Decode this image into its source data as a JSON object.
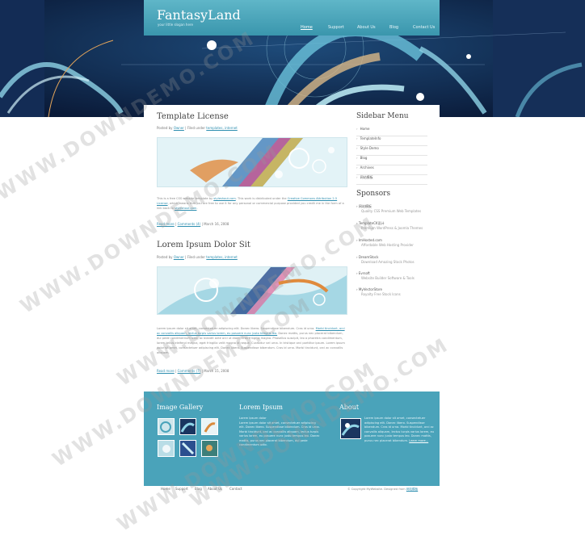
{
  "site": {
    "logo": "FantasyLand",
    "slogan": "your little slogan here"
  },
  "nav": [
    {
      "label": "Home",
      "active": true
    },
    {
      "label": "Support"
    },
    {
      "label": "About Us"
    },
    {
      "label": "Blog"
    },
    {
      "label": "Contact Us"
    }
  ],
  "posts": [
    {
      "title": "Template License",
      "meta_prefix": "Posted by",
      "author": "Owner",
      "meta_mid": "| Filed under",
      "tags": "templates, internet",
      "excerpt_a": "This is a free CSS website template by",
      "excerpt_link1": "styleshout.com",
      "excerpt_b": ". This work is distributed under the",
      "excerpt_link2": "Creative Commons Attribution 2.5 License",
      "excerpt_c": ", which means that you are free to use it for any personal or commercial purpose provided you credit me in the form of a link back to",
      "excerpt_link3": "styleshout.com",
      "readmore": "Read more",
      "comments": "Comments (4)",
      "date": "| March 16, 2008"
    },
    {
      "title": "Lorem Ipsum Dolor Sit",
      "meta_prefix": "Posted by",
      "author": "Owner",
      "meta_mid": "| Filed under",
      "tags": "templates, internet",
      "excerpt_a": "Lorem ipsum dolor sit amet, consectetuer adipiscing elit. Donec libero. Suspendisse bibendum. Cras id urna.",
      "excerpt_link1": "Morbi tincidunt, orci ac convallis aliquam, lectus turpis varius lorem, eu posuere nunc justo tempus leo.",
      "excerpt_b": "Donec mattis, purus nec placerat bibendum, dui pede condimentum odio, ac blandit ante orci ut diam. Cras fringilla magna. Phasellus suscipit, leo a pharetra condimentum, lorem tellus eleifend magna, eget fringilla velit magna id neque. Curabitur vel urna. In tristique orci porttitor ipsum. Lorem ipsum dolor sit amet, consectetuer adipiscing elit. Donec libero. Suspendisse bibendum. Cras id urna. Morbi tincidunt, orci ac convallis aliquam.",
      "readmore": "Read more",
      "comments": "Comments (7)",
      "date": "| March 15, 2008"
    }
  ],
  "sidebar": {
    "menu_title": "Sidebar Menu",
    "menu": [
      "Home",
      "TemplateInfo",
      "Style Demo",
      "Blog",
      "Archives",
      "网站模板"
    ],
    "sponsors_title": "Sponsors",
    "sponsors": [
      {
        "name": "网站模板",
        "desc": "Quality CSS Premium Web Templates"
      },
      {
        "name": "TemplateCK设计",
        "desc": "Premium WordPress & Joomla Themes"
      },
      {
        "name": "ImHosted.com",
        "desc": "Affordable Web Hosting Provider"
      },
      {
        "name": "DreamStock",
        "desc": "Download Amazing Stock Photos"
      },
      {
        "name": "Evrsoft",
        "desc": "Website Builder Software & Tools"
      },
      {
        "name": "MyVectorStore",
        "desc": "Royalty Free Stock Icons"
      }
    ]
  },
  "footer": {
    "gallery_title": "Image Gallery",
    "lorem_title": "Lorem Ipsum",
    "lorem_strong": "Lorem ipsum dolor",
    "lorem_text": "Lorem ipsum dolor sit amet, consectetuer adipiscing elit. Donec libero. Suspendisse bibendum. Cras id urna. Morbi tincidunt, orci ac convallis aliquam, lectus turpis varius lorem, eu posuere nunc justo tempus leo. Donec mattis, purus nec placerat bibendum, dui pede condimentum odio.",
    "about_title": "About",
    "about_text": "Lorem ipsum dolor sit amet, consectetuer adipiscing elit. Donec libero. Suspendisse bibendum. Cras id urna. Morbi tincidunt, orci ac convallis aliquam, lectus turpis varius lorem, eu posuere nunc justo tempus leo. Donec mattis, purus nec placerat bibendum.",
    "learn_more": "Learn more...",
    "colors": {
      "bg": "#4aa3ba",
      "accent": "#2f8fb0"
    }
  },
  "bottom_nav": [
    "Home",
    "Support",
    "Blog",
    "About Us",
    "Contact"
  ],
  "copyright_prefix": "© Copyright MyWebsite. Designed from",
  "copyright_link": "网站模板",
  "watermark": "WWW.DOWNDEMO.COM"
}
